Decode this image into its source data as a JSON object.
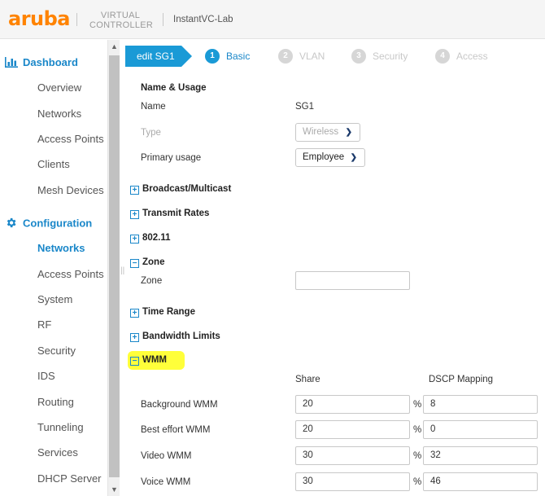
{
  "header": {
    "logo": "aruba",
    "virtual_line1": "VIRTUAL",
    "virtual_line2": "CONTROLLER",
    "controller_name": "InstantVC-Lab"
  },
  "sidebar": {
    "dashboard": {
      "title": "Dashboard",
      "items": [
        "Overview",
        "Networks",
        "Access Points",
        "Clients",
        "Mesh Devices"
      ]
    },
    "configuration": {
      "title": "Configuration",
      "items": [
        "Networks",
        "Access Points",
        "System",
        "RF",
        "Security",
        "IDS",
        "Routing",
        "Tunneling",
        "Services",
        "DHCP Server"
      ],
      "active": "Networks"
    }
  },
  "wizard": {
    "edit_label": "edit SG1",
    "steps": [
      {
        "num": "1",
        "label": "Basic"
      },
      {
        "num": "2",
        "label": "VLAN"
      },
      {
        "num": "3",
        "label": "Security"
      },
      {
        "num": "4",
        "label": "Access"
      }
    ]
  },
  "form": {
    "name_usage_title": "Name & Usage",
    "name_label": "Name",
    "name_value": "SG1",
    "type_label": "Type",
    "type_value": "Wireless",
    "primary_usage_label": "Primary usage",
    "primary_usage_value": "Employee",
    "sections": {
      "broadcast": "Broadcast/Multicast",
      "transmit": "Transmit Rates",
      "dot11": "802.11",
      "zone": "Zone",
      "time_range": "Time Range",
      "bandwidth": "Bandwidth Limits",
      "wmm": "WMM"
    },
    "zone_label": "Zone",
    "zone_value": "",
    "wmm": {
      "share_header": "Share",
      "dscp_header": "DSCP Mapping",
      "percent": "%",
      "rows": [
        {
          "label": "Background WMM",
          "share": "20",
          "dscp": "8"
        },
        {
          "label": "Best effort WMM",
          "share": "20",
          "dscp": "0"
        },
        {
          "label": "Video WMM",
          "share": "30",
          "dscp": "32"
        },
        {
          "label": "Voice WMM",
          "share": "30",
          "dscp": "46"
        }
      ]
    }
  }
}
